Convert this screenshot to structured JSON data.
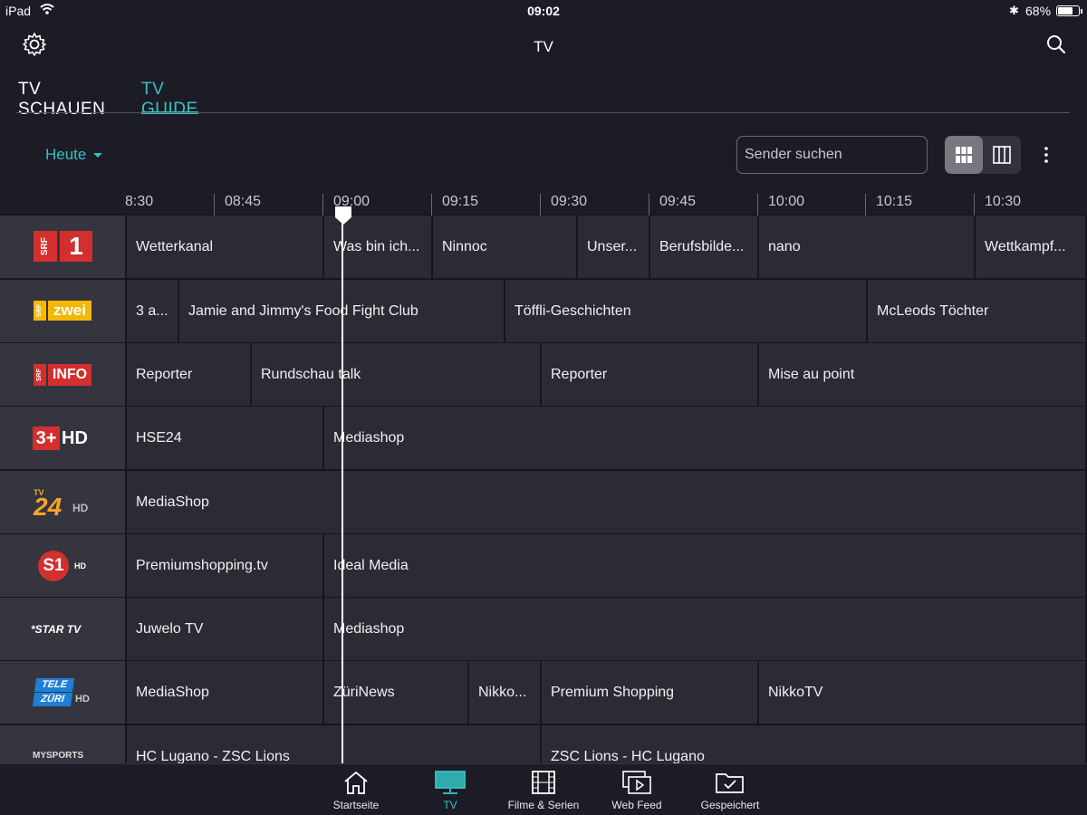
{
  "status_bar": {
    "device": "iPad",
    "time": "09:02",
    "battery": "68%",
    "battery_level": 0.68
  },
  "header": {
    "title": "TV",
    "icons": [
      "gear-icon",
      "search-icon"
    ]
  },
  "tabs": [
    {
      "label": "TV SCHAUEN",
      "active": false
    },
    {
      "label": "TV GUIDE",
      "active": true
    }
  ],
  "day_selector": {
    "label": "Heute"
  },
  "search": {
    "placeholder": "Sender suchen"
  },
  "view_toggle": {
    "options": [
      "grid-view-icon",
      "columns-view-icon"
    ],
    "selected": "grid-view-icon"
  },
  "timeline": {
    "labels": [
      "8:30",
      "08:45",
      "09:00",
      "09:15",
      "09:30",
      "09:45",
      "10:00",
      "10:15",
      "10:30"
    ],
    "now": "09:02"
  },
  "channels": [
    {
      "name": "SRF 1",
      "logo_text": [
        "SRF",
        "1"
      ],
      "programs": [
        "Wetterkanal",
        "Was bin ich...",
        "Ninnoc",
        "Unser...",
        "Berufsbilde...",
        "nano",
        "Wettkampf..."
      ]
    },
    {
      "name": "SRF zwei",
      "logo_text": [
        "SRF",
        "zwei"
      ],
      "programs": [
        "3 a...",
        "Jamie and Jimmy's Food Fight Club",
        "Töffli-Geschichten",
        "McLeods Töchter"
      ]
    },
    {
      "name": "SRF info",
      "logo_text": [
        "SRF",
        "INFO"
      ],
      "programs": [
        "Reporter",
        "Rundschau talk",
        "Reporter",
        "Mise au point"
      ]
    },
    {
      "name": "3+ HD",
      "logo_text": [
        "3+",
        "HD"
      ],
      "programs": [
        "HSE24",
        "Mediashop"
      ]
    },
    {
      "name": "TV24 HD",
      "logo_text": [
        "TV",
        "24",
        "HD"
      ],
      "programs": [
        "MediaShop"
      ]
    },
    {
      "name": "S1 HD",
      "logo_text": [
        "S1",
        "HD"
      ],
      "programs": [
        "Premiumshopping.tv",
        "Ideal Media"
      ]
    },
    {
      "name": "Star TV",
      "logo_text": [
        "*STAR TV"
      ],
      "programs": [
        "Juwelo TV",
        "Mediashop"
      ]
    },
    {
      "name": "Tele Züri HD",
      "logo_text": [
        "TELE",
        "ZÜRI",
        "HD"
      ],
      "programs": [
        "MediaShop",
        "ZüriNews",
        "Nikko...",
        "Premium Shopping",
        "NikkoTV"
      ]
    },
    {
      "name": "MySports",
      "logo_text": [
        "MYSPORTS"
      ],
      "programs": [
        "HC Lugano - ZSC Lions",
        "ZSC Lions - HC Lugano"
      ]
    }
  ],
  "bottom_nav": [
    {
      "label": "Startseite",
      "icon": "home-icon",
      "active": false
    },
    {
      "label": "TV",
      "icon": "tv-icon",
      "active": true
    },
    {
      "label": "Filme & Serien",
      "icon": "film-icon",
      "active": false
    },
    {
      "label": "Web Feed",
      "icon": "web-feed-icon",
      "active": false
    },
    {
      "label": "Gespeichert",
      "icon": "saved-folder-icon",
      "active": false
    }
  ],
  "colors": {
    "accent": "#36c2c2",
    "background": "#16161f",
    "cell": "#2b2b35",
    "logo_cell": "#35353f",
    "srf_red": "#d32f2f",
    "srf_zwei_yellow": "#f5b800"
  }
}
